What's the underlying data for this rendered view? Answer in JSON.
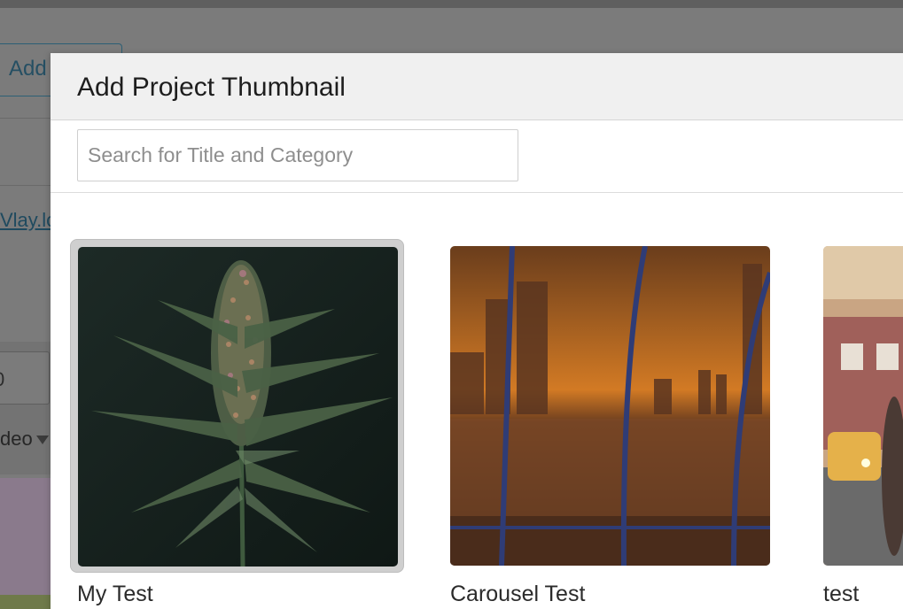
{
  "background": {
    "add_button_label": "Add",
    "link_text": "Vlay.lo",
    "number_value": "0",
    "select_value": "deo"
  },
  "modal": {
    "title": "Add Project Thumbnail",
    "search": {
      "placeholder": "Search for Title and Category",
      "value": ""
    },
    "thumbnails": [
      {
        "title": "My Test",
        "selected": true,
        "image": "cannabis-plant-photo"
      },
      {
        "title": "Carousel Test",
        "selected": false,
        "image": "city-sunset-window-photo"
      },
      {
        "title": "test",
        "selected": false,
        "image": "street-scene-photo"
      }
    ]
  },
  "colors": {
    "overlay": "#7f7f7f",
    "modal_header": "#f0f0f0",
    "selected_frame": "#cfcfcf",
    "link": "#1f4a5f"
  }
}
